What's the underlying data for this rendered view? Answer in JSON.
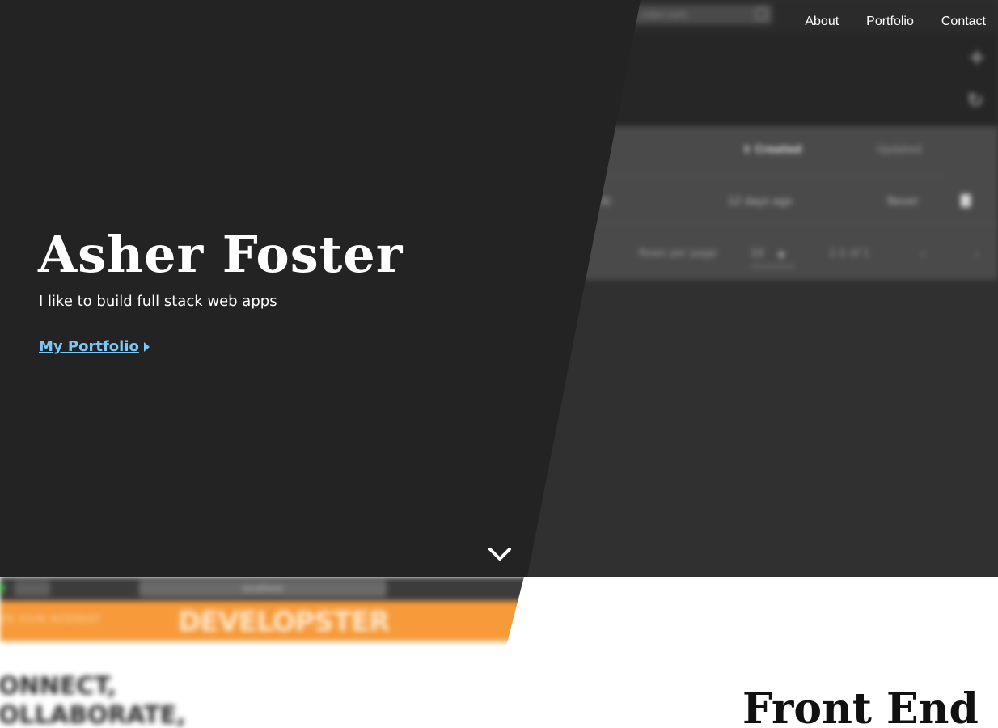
{
  "nav": {
    "items": [
      {
        "label": "About"
      },
      {
        "label": "Portfolio"
      },
      {
        "label": "Contact"
      }
    ]
  },
  "hero": {
    "title": "Asher Foster",
    "subtitle": "I like to build full stack web apps",
    "cta_label": "My Portfolio"
  },
  "background_preview": {
    "url": "…nder.com",
    "columns": {
      "created": "⬆ Created",
      "updated": "Updated"
    },
    "row": {
      "id": "…6/",
      "created": "12 days ago",
      "updated": "Never"
    },
    "pagination": {
      "rows_per_page_label": "Rows per page",
      "rows_per_page_value": "10",
      "range": "1-1 of 1"
    }
  },
  "section2": {
    "title": "Front End",
    "project_preview": {
      "url": "localhost",
      "search_placeholder": "ER YOUR INTEREST",
      "logo": "DEVELOPSTER",
      "headline": [
        "ONNECT,",
        "OLLABORATE,"
      ]
    }
  },
  "colors": {
    "hero_bg": "#232323",
    "link": "#7cc7f5",
    "accent_orange": "#f69a3a"
  }
}
